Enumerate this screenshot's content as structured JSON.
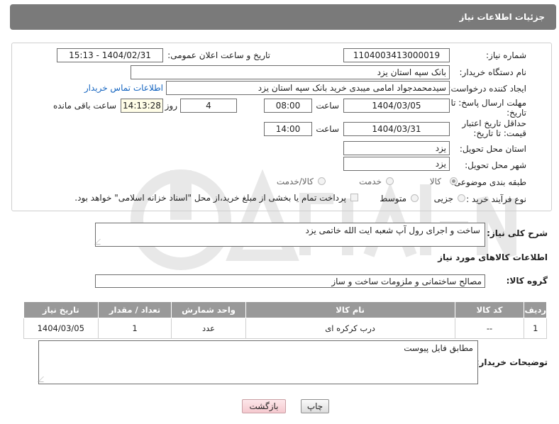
{
  "header": {
    "title": "جزئیات اطلاعات نیاز"
  },
  "form": {
    "need_number": {
      "label": "شماره نیاز:",
      "value": "1104003413000019"
    },
    "announce": {
      "label": "تاریخ و ساعت اعلان عمومی:",
      "value": "1404/02/31 - 15:13"
    },
    "buyer_org": {
      "label": "نام دستگاه خریدار:",
      "value": "بانک سپه استان یزد"
    },
    "creator": {
      "label": "ایجاد کننده درخواست:",
      "value": "سیدمحمدجواد امامی میبدی خرید   بانک سپه استان یزد",
      "contact_link": "اطلاعات تماس خریدار"
    },
    "reply_deadline": {
      "label": "مهلت ارسال پاسخ: تا تاریخ:",
      "date": "1404/03/05",
      "time_label": "ساعت",
      "time": "08:00",
      "days": "4",
      "days_label": "روز و",
      "remaining": "14:13:28",
      "remaining_label": "ساعت باقی مانده"
    },
    "price_validity": {
      "label": "حداقل تاریخ اعتبار قیمت: تا تاریخ:",
      "date": "1404/03/31",
      "time_label": "ساعت",
      "time": "14:00"
    },
    "delivery_province": {
      "label": "استان محل تحویل:",
      "value": "یزد"
    },
    "delivery_city": {
      "label": "شهر محل تحویل:",
      "value": "یزد"
    },
    "category": {
      "label": "طبقه بندی موضوعی:",
      "options": [
        "کالا",
        "خدمت",
        "کالا/خدمت"
      ],
      "selected": "کالا"
    },
    "purchase_process": {
      "label": "نوع فرآیند خرید :",
      "options": [
        "جزیی",
        "متوسط"
      ],
      "checkbox_text": "پرداخت تمام یا بخشی از مبلغ خرید،از محل \"اسناد خزانه اسلامی\" خواهد بود."
    }
  },
  "summary": {
    "label": "شرح کلی نیاز:",
    "value": "ساخت و اجرای رول آپ شعبه ایت الله خاتمی یزد"
  },
  "goods_section": {
    "title": "اطلاعات کالاهای مورد نیاز"
  },
  "goods_group": {
    "label": "گروه کالا:",
    "value": "مصالح ساختمانی و ملزومات ساخت و ساز"
  },
  "items_table": {
    "columns": [
      "ردیف",
      "کد کالا",
      "نام کالا",
      "واحد شمارش",
      "تعداد / مقدار",
      "تاریخ نیاز"
    ],
    "rows": [
      [
        "1",
        "--",
        "درب کرکره ای",
        "عدد",
        "1",
        "1404/03/05"
      ]
    ]
  },
  "buyer_notes": {
    "label": "توضیحات خریدار:",
    "value": "مطابق فایل پیوست"
  },
  "buttons": {
    "print": "چاپ",
    "back": "بازگشت"
  },
  "colors": {
    "header_bg": "#7a7a7a",
    "table_header_bg": "#999999",
    "link": "#1565c0",
    "back_button": "#f5c9cf"
  }
}
